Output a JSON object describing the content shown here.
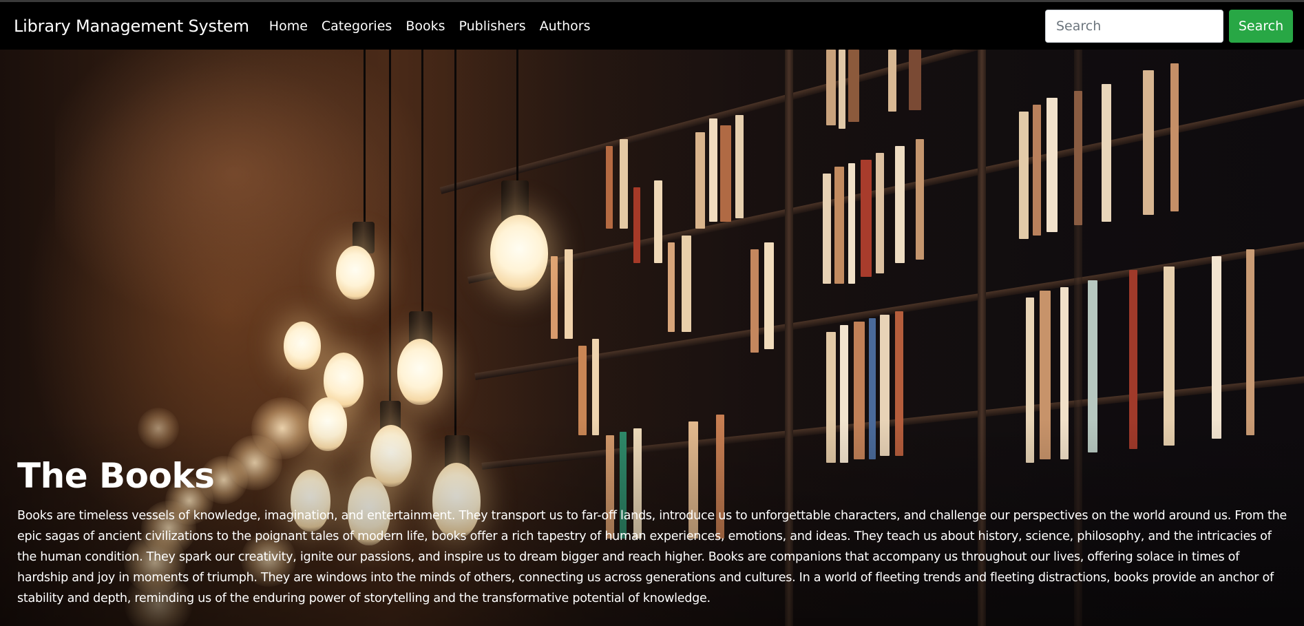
{
  "navbar": {
    "brand": "Library Management System",
    "links": [
      {
        "label": "Home"
      },
      {
        "label": "Categories"
      },
      {
        "label": "Books"
      },
      {
        "label": "Publishers"
      },
      {
        "label": "Authors"
      }
    ],
    "search": {
      "placeholder": "Search",
      "value": "",
      "button_label": "Search"
    }
  },
  "hero": {
    "title": "The Books",
    "text": "Books are timeless vessels of knowledge, imagination, and entertainment. They transport us to far-off lands, introduce us to unforgettable characters, and challenge our perspectives on the world around us. From the epic sagas of ancient civilizations to the poignant tales of modern life, books offer a rich tapestry of human experiences, emotions, and ideas. They teach us about history, science, philosophy, and the intricacies of the human condition. They spark our creativity, ignite our passions, and inspire us to dream bigger and reach higher. Books are companions that accompany us throughout our lives, offering solace in times of hardship and joy in moments of triumph. They are windows into the minds of others, connecting us across generations and cultures. In a world of fleeting trends and fleeting distractions, books provide an anchor of stability and depth, reminding us of the enduring power of storytelling and the transformative potential of knowledge.",
    "background_image": "library bookshelves with hanging light bulbs"
  },
  "colors": {
    "navbar_bg": "#000000",
    "search_button": "#28a745",
    "text": "#ffffff"
  }
}
